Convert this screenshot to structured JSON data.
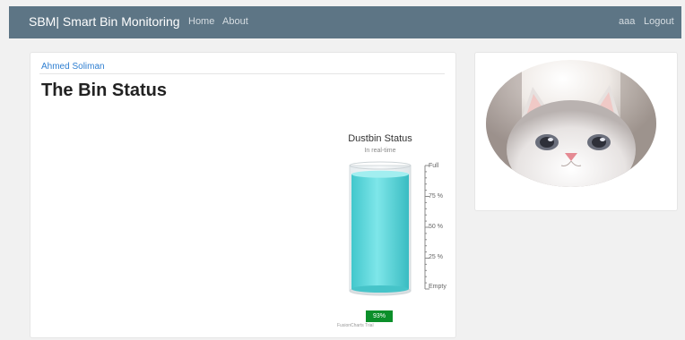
{
  "navbar": {
    "brand": "SBM| Smart Bin Monitoring",
    "links": [
      "Home",
      "About"
    ],
    "user": "aaa",
    "logout": "Logout",
    "bg_color": "#5d7585"
  },
  "main": {
    "author": "Ahmed Soliman",
    "title": "The Bin Status"
  },
  "gauge": {
    "title": "Dustbin Status",
    "subtitle": "In real-time",
    "ticks": [
      "Full",
      "75 %",
      "50 %",
      "25 %",
      "Empty"
    ],
    "value_percent": 93,
    "value_label": "93%",
    "credits": "FusionCharts Trial",
    "fill_color": "#5fd8dc",
    "value_box_color": "#0b8f2a"
  },
  "sidebar": {
    "image": "cat-photo"
  }
}
